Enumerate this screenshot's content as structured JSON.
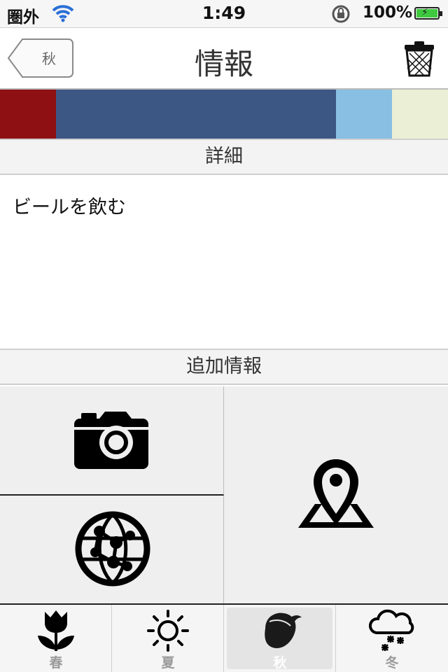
{
  "status_bar": {
    "carrier": "圏外",
    "time": "1:49",
    "battery": "100%"
  },
  "nav": {
    "back_label": "秋",
    "title": "情報"
  },
  "color_strip": [
    "#8e1012",
    "#3d5785",
    "#3d5785",
    "#3d5785",
    "#3d5785",
    "#3d5785",
    "#88bfe2",
    "#ebefd5"
  ],
  "detail": {
    "header": "詳細",
    "text": "ビールを飲む"
  },
  "extra": {
    "header": "追加情報"
  },
  "tabs": [
    {
      "label": "春",
      "icon": "tulip-icon"
    },
    {
      "label": "夏",
      "icon": "sun-icon"
    },
    {
      "label": "秋",
      "icon": "acorn-icon",
      "active": true
    },
    {
      "label": "冬",
      "icon": "snow-cloud-icon"
    }
  ]
}
